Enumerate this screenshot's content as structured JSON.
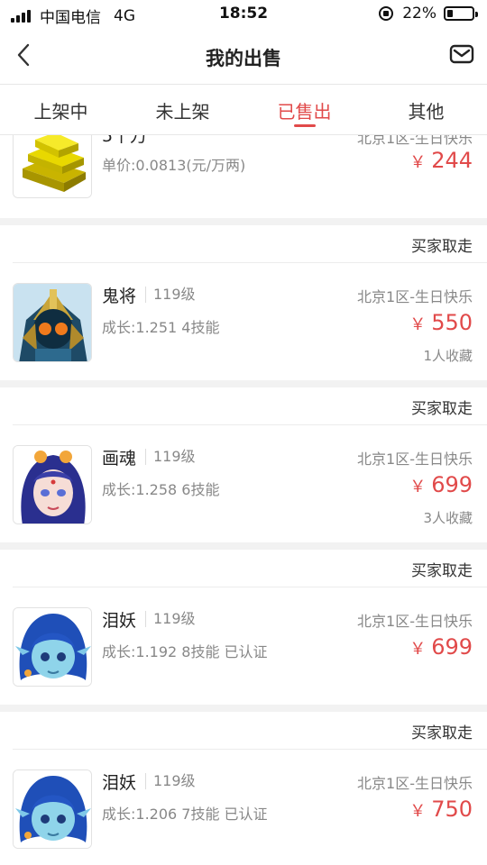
{
  "status": {
    "carrier": "中国电信",
    "network": "4G",
    "time": "18:52",
    "battery": "22%",
    "battery_level": 0.22
  },
  "header": {
    "title": "我的出售"
  },
  "tabs": [
    {
      "label": "上架中"
    },
    {
      "label": "未上架"
    },
    {
      "label": "已售出"
    },
    {
      "label": "其他"
    }
  ],
  "items": [
    {
      "title_partial": "5千万",
      "server_partial": "北京1区-生日快乐",
      "desc": "单价:0.0813(元/万两)",
      "currency": "￥",
      "price": "244"
    },
    {
      "status": "买家取走",
      "name": "鬼将",
      "level": "119级",
      "desc": "成长:1.251 4技能",
      "server": "北京1区-生日快乐",
      "currency": "￥",
      "price": "550",
      "favs": "1人收藏"
    },
    {
      "status": "买家取走",
      "name": "画魂",
      "level": "119级",
      "desc": "成长:1.258 6技能",
      "server": "北京1区-生日快乐",
      "currency": "￥",
      "price": "699",
      "favs": "3人收藏"
    },
    {
      "status": "买家取走",
      "name": "泪妖",
      "level": "119级",
      "desc": "成长:1.192 8技能 已认证",
      "server": "北京1区-生日快乐",
      "currency": "￥",
      "price": "699"
    },
    {
      "status": "买家取走",
      "name": "泪妖",
      "level": "119级",
      "desc": "成长:1.206 7技能 已认证",
      "server": "北京1区-生日快乐",
      "currency": "￥",
      "price": "750"
    }
  ],
  "colors": {
    "accent": "#e14a4a",
    "text": "#333333",
    "muted": "#888888",
    "background": "#f2f2f2"
  }
}
